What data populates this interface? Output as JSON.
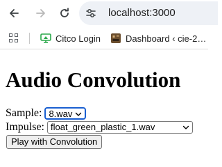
{
  "browser": {
    "url": "localhost:3000",
    "icons": {
      "back": "arrow-left-icon",
      "forward": "arrow-right-icon",
      "reload": "reload-icon",
      "site_info": "site-info-icon"
    }
  },
  "bookmarks": {
    "apps_icon": "apps-grid-icon",
    "items": [
      {
        "label": "Citco Login",
        "icon": "citco-favicon",
        "color": "#2aa84a"
      },
      {
        "label": "Dashboard ‹ cie-2…",
        "icon": "dashboard-favicon",
        "color": "#6b4e2e"
      }
    ]
  },
  "page": {
    "title": "Audio Convolution",
    "sample": {
      "label": "Sample:",
      "value": "8.wav"
    },
    "impulse": {
      "label": "Impulse:",
      "value": "float_green_plastic_1.wav"
    },
    "play_button": "Play with Convolution"
  },
  "colors": {
    "focus_ring": "#1a5fd1",
    "omnibox_bg": "#eef1f6"
  }
}
